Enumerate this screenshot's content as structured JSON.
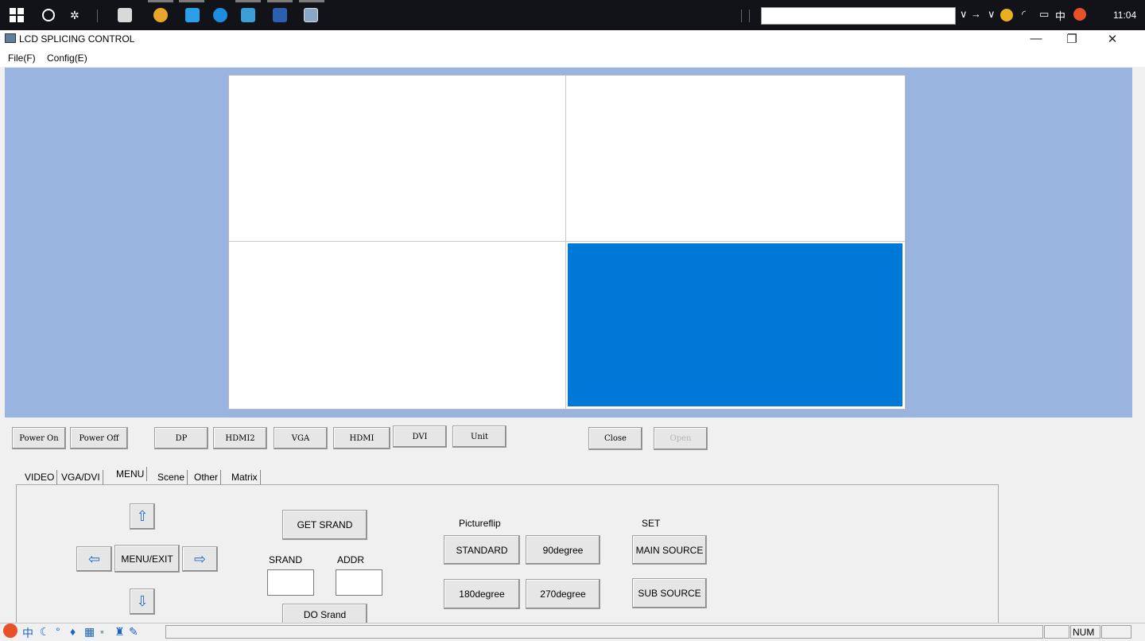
{
  "taskbar": {
    "clock": "11:04",
    "ime_char": "中",
    "colors": {
      "background": "#111318"
    },
    "icons": [
      "windows-start-icon",
      "cortana-icon",
      "taskview-icon",
      "mail-icon",
      "chrome-icon",
      "ie-icon",
      "skype-icon",
      "file-explorer-icon",
      "word-icon",
      "lcd-app-icon"
    ]
  },
  "window": {
    "title": "LCD SPLICING CONTROL",
    "minimize": "—",
    "restore": "❐",
    "close": "✕"
  },
  "menubar": {
    "file": "File(F)",
    "config": "Config(E)"
  },
  "wall": {
    "rows": 2,
    "cols": 2,
    "selected_cell": 4,
    "colors": {
      "canvas_bg": "#99b4df",
      "selected": "#0078d7"
    }
  },
  "toolbar": {
    "power_on": "Power On",
    "power_off": "Power Off",
    "dp": "DP",
    "hdmi2": "HDMI2",
    "vga": "VGA",
    "hdmi": "HDMI",
    "dvi": "DVI",
    "unit": "Unit",
    "close": "Close",
    "open": "Open"
  },
  "tabs": [
    {
      "label": "VIDEO",
      "active": false
    },
    {
      "label": "VGA/DVI",
      "active": false
    },
    {
      "label": "MENU",
      "active": true
    },
    {
      "label": "Scene",
      "active": false
    },
    {
      "label": "Other",
      "active": false
    },
    {
      "label": "Matrix",
      "active": false
    }
  ],
  "menu_panel": {
    "up": "⇧",
    "down": "⇩",
    "left": "⇦",
    "right": "⇨",
    "menu_exit": "MENU/EXIT",
    "get_srand": "GET SRAND",
    "srand_label": "SRAND",
    "addr_label": "ADDR",
    "srand_value": "",
    "addr_value": "",
    "do_srand": "DO Srand",
    "pictureflip_label": "Pictureflip",
    "standard": "STANDARD",
    "deg90": "90degree",
    "deg180": "180degree",
    "deg270": "270degree",
    "set_label": "SET",
    "main_source": "MAIN SOURCE",
    "sub_source": "SUB SOURCE"
  },
  "statusbar": {
    "num": "NUM"
  }
}
